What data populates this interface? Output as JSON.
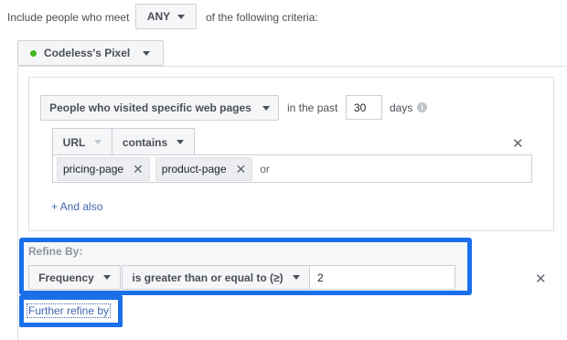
{
  "header": {
    "prefix": "Include people who meet",
    "match_value": "ANY",
    "suffix": "of the following criteria:"
  },
  "source": {
    "label": "Codeless's Pixel",
    "status_color": "#42b72a"
  },
  "rule": {
    "visit_type": "People who visited specific web pages",
    "in_the_past": "in the past",
    "days_value": "30",
    "days_label": "days",
    "info_glyph": "i",
    "url_label": "URL",
    "operator": "contains",
    "tags": [
      "pricing-page",
      "product-page"
    ],
    "or_label": "or",
    "and_also": "+ And also"
  },
  "refine": {
    "title": "Refine By:",
    "metric": "Frequency",
    "comparator": "is greater than or equal to (≥)",
    "value": "2",
    "further": "Further refine by"
  },
  "colors": {
    "highlight": "#1a6fe8",
    "link": "#4267b2"
  }
}
